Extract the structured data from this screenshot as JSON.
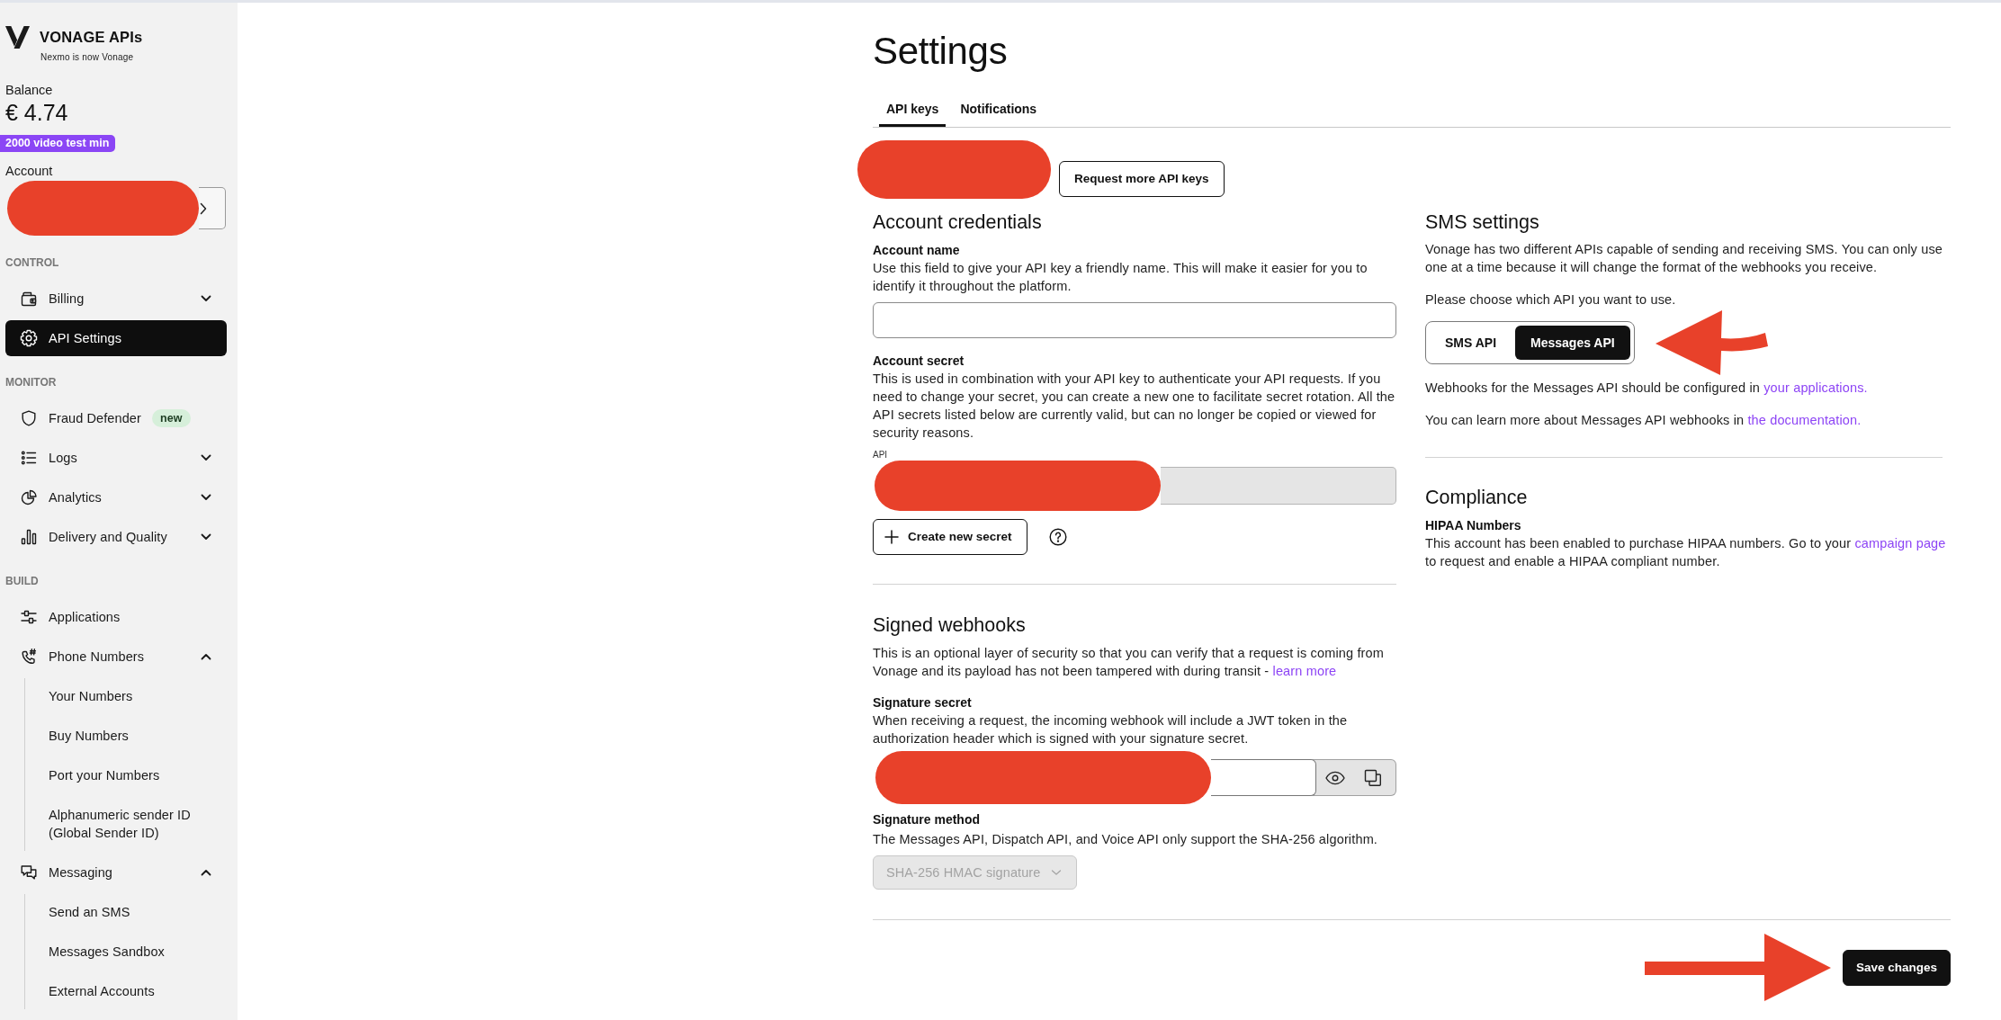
{
  "sidebar": {
    "brand": {
      "name": "VONAGE APIs",
      "tagline": "Nexmo is now Vonage"
    },
    "balance": {
      "label": "Balance",
      "amount": "€ 4.74",
      "badge": "2000 video test min"
    },
    "account": {
      "label": "Account",
      "redacted": true
    },
    "sections": [
      {
        "heading": "CONTROL",
        "items": [
          {
            "label": "Billing",
            "selected": false,
            "expanded": false
          },
          {
            "label": "API Settings",
            "selected": true
          }
        ]
      },
      {
        "heading": "MONITOR",
        "items": [
          {
            "label": "Fraud Defender",
            "selected": false,
            "badge": "new"
          },
          {
            "label": "Logs",
            "selected": false,
            "expanded": false
          },
          {
            "label": "Analytics",
            "selected": false,
            "expanded": false
          },
          {
            "label": "Delivery and Quality",
            "selected": false,
            "expanded": false
          }
        ]
      },
      {
        "heading": "BUILD",
        "items": [
          {
            "label": "Applications",
            "selected": false
          },
          {
            "label": "Phone Numbers",
            "selected": false,
            "expanded": true,
            "children": [
              {
                "label": "Your Numbers",
                "selected": false
              },
              {
                "label": "Buy Numbers",
                "selected": false
              },
              {
                "label": "Port your Numbers",
                "selected": false
              },
              {
                "label": "Alphanumeric sender ID (Global Sender ID)",
                "selected": false
              }
            ]
          },
          {
            "label": "Messaging",
            "selected": false,
            "expanded": true,
            "children": [
              {
                "label": "Send an SMS",
                "selected": false
              },
              {
                "label": "Messages Sandbox",
                "selected": false
              },
              {
                "label": "External Accounts",
                "selected": false
              }
            ]
          }
        ]
      }
    ]
  },
  "header": {
    "title": "Settings",
    "tabs": [
      {
        "label": "API keys",
        "selected": true
      },
      {
        "label": "Notifications",
        "selected": false
      }
    ]
  },
  "api_keys": {
    "key_select": {
      "redacted": true
    },
    "request_button": "Request more API keys"
  },
  "account_credentials": {
    "title": "Account credentials",
    "account_name": {
      "label": "Account name",
      "help": "Use this field to give your API key a friendly name. This will make it easier for you to identify it throughout the platform."
    },
    "account_secret": {
      "label": "Account secret",
      "help": "This is used in combination with your API key to authenticate your API requests. If you need to change your secret, you can create a new one to facilitate secret rotation. All the API secrets listed below are currently valid, but can no longer be copied or viewed for security reasons.",
      "field_label": "API",
      "redacted": true,
      "create_button": "Create new secret"
    }
  },
  "signed_webhooks": {
    "title": "Signed webhooks",
    "description": "This is an optional layer of security so that you can verify that a request is coming from Vonage and its payload has not been tampered with during transit - ",
    "link": "learn more",
    "signature_secret": {
      "label": "Signature secret",
      "help": "When receiving a request, the incoming webhook will include a JWT token in the authorization header which is signed with your signature secret.",
      "redacted": true
    },
    "signature_method": {
      "label": "Signature method",
      "help": "The Messages API, Dispatch API, and Voice API only support the SHA-256 algorithm.",
      "value": "SHA-256 HMAC signature",
      "disabled": true
    }
  },
  "sms_settings": {
    "title": "SMS settings",
    "description": "Vonage has two different APIs capable of sending and receiving SMS. You can only use one at a time because it will change the format of the webhooks you receive.",
    "prompt": "Please choose which API you want to use.",
    "options": [
      {
        "label": "SMS API",
        "selected": false
      },
      {
        "label": "Messages API",
        "selected": true
      }
    ],
    "annotated": true,
    "notes": [
      {
        "text": "Webhooks for the Messages API should be configured in ",
        "link": "your applications."
      },
      {
        "text": "You can learn more about Messages API webhooks in ",
        "link": "the documentation."
      }
    ]
  },
  "compliance": {
    "title": "Compliance",
    "label": "HIPAA Numbers",
    "text": "This account has been enabled to purchase HIPAA numbers. Go to your ",
    "link": "campaign page",
    "text_after": " to request and enable a HIPAA compliant number."
  },
  "footer": {
    "save_button": "Save changes",
    "annotated": true
  }
}
